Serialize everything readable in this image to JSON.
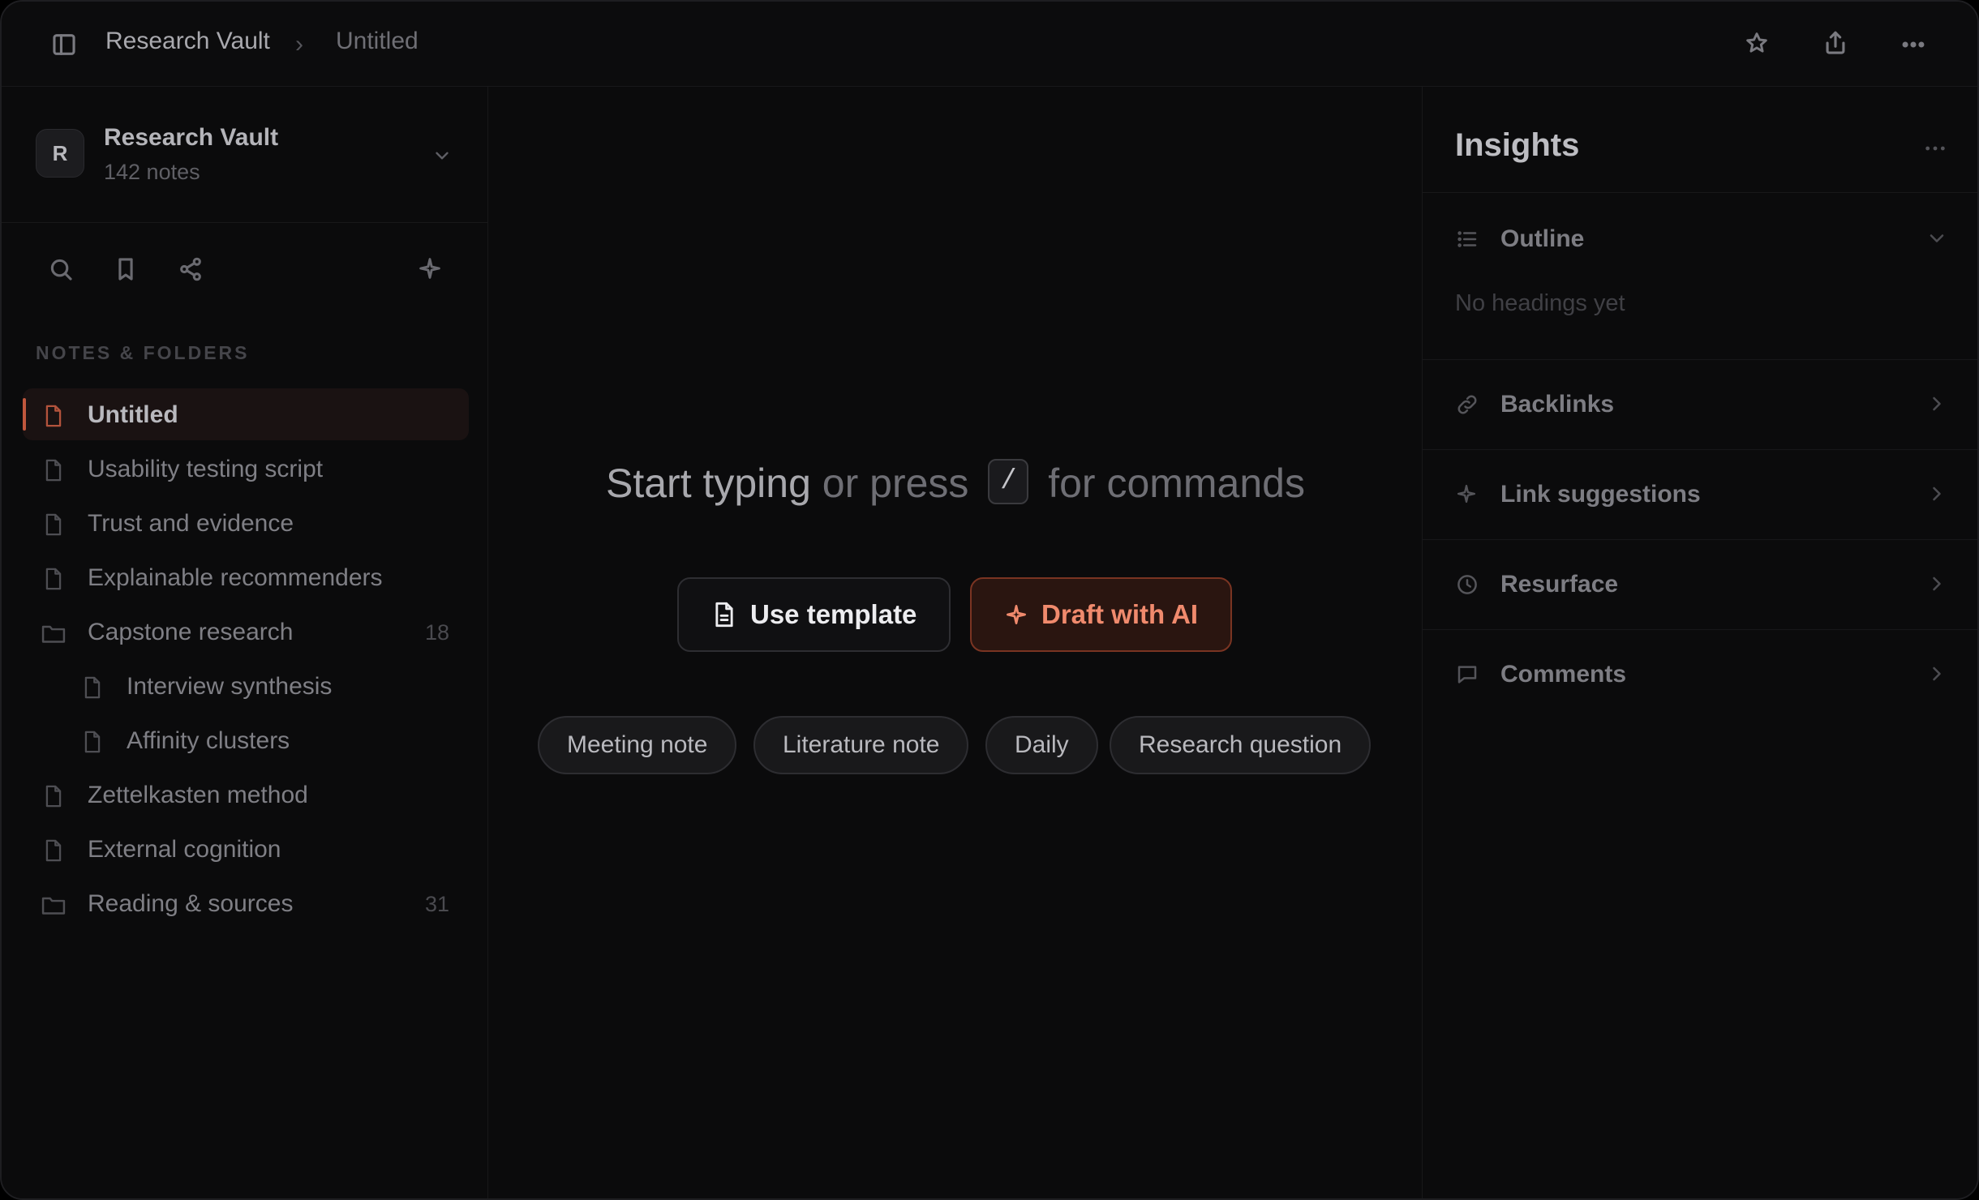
{
  "topbar": {
    "breadcrumb_root": "Research Vault",
    "breadcrumb_separator": "›",
    "breadcrumb_current": "Untitled",
    "icons": [
      "sidebar-toggle-icon",
      "star-icon",
      "share-icon",
      "more-icon"
    ]
  },
  "sidebar": {
    "vault": {
      "avatar_letter": "R",
      "name": "Research Vault",
      "count": "142 notes"
    },
    "tools": [
      "search-icon",
      "bookmark-icon",
      "graph-share-icon",
      "sparkle-icon"
    ],
    "section_label": "NOTES & FOLDERS",
    "items": [
      {
        "label": "Untitled",
        "type": "file",
        "active": true
      },
      {
        "label": "Usability testing script",
        "type": "file"
      },
      {
        "label": "Trust and evidence",
        "type": "file"
      },
      {
        "label": "Explainable recommenders",
        "type": "file"
      },
      {
        "label": "Capstone research",
        "type": "folder",
        "count": "18"
      },
      {
        "label": "Interview synthesis",
        "type": "file",
        "indent": true
      },
      {
        "label": "Affinity clusters",
        "type": "file",
        "indent": true
      },
      {
        "label": "Zettelkasten method",
        "type": "file"
      },
      {
        "label": "External cognition",
        "type": "file"
      },
      {
        "label": "Reading & sources",
        "type": "folder",
        "count": "31"
      }
    ]
  },
  "main": {
    "prompt": {
      "part1": "Start typing",
      "part2": " or press ",
      "key": "/",
      "part3": " for commands"
    },
    "buttons": {
      "template": "Use template",
      "ai": "Draft with AI"
    },
    "chips": [
      "Meeting note",
      "Literature note",
      "Daily",
      "Research question"
    ]
  },
  "insights": {
    "title": "Insights",
    "sections": {
      "outline": {
        "label": "Outline",
        "empty": "No headings yet"
      },
      "backlinks": {
        "label": "Backlinks"
      },
      "link_suggestions": {
        "label": "Link suggestions"
      },
      "resurface": {
        "label": "Resurface"
      },
      "comments": {
        "label": "Comments"
      }
    }
  },
  "colors": {
    "accent": "#f08a6d",
    "accent_border": "#7a3422",
    "background": "#0b0b0c"
  }
}
